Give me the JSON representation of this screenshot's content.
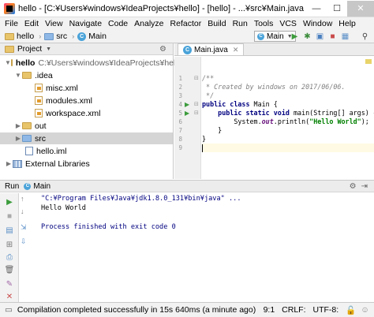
{
  "window": {
    "title": "hello - [C:¥Users¥windows¥IdeaProjects¥hello] - [hello] - ...¥src¥Main.java - IntelliJ IDEA 2017...",
    "minimize_glyph": "—",
    "maximize_glyph": "☐",
    "close_glyph": "✕"
  },
  "menu": [
    "File",
    "Edit",
    "View",
    "Navigate",
    "Code",
    "Analyze",
    "Refactor",
    "Build",
    "Run",
    "Tools",
    "VCS",
    "Window",
    "Help"
  ],
  "breadcrumbs": [
    "hello",
    "src",
    "Main"
  ],
  "toolbar": {
    "run_config": "Main",
    "icons": [
      "run-icon",
      "debug-icon",
      "coverage-icon",
      "stop-icon",
      "search-icon"
    ]
  },
  "project_panel": {
    "header": "Project",
    "tree": [
      {
        "label": "hello",
        "path": "C:¥Users¥windows¥IdeaProjects¥hello",
        "type": "folder",
        "expanded": true
      },
      {
        "label": ".idea",
        "type": "folder",
        "expanded": true
      },
      {
        "label": "misc.xml",
        "type": "xml"
      },
      {
        "label": "modules.xml",
        "type": "xml"
      },
      {
        "label": "workspace.xml",
        "type": "xml"
      },
      {
        "label": "out",
        "type": "folder",
        "expanded": false
      },
      {
        "label": "src",
        "type": "folder-blue",
        "expanded": false,
        "selected": true
      },
      {
        "label": "hello.iml",
        "type": "iml"
      },
      {
        "label": "External Libraries",
        "type": "libs",
        "expanded": false
      }
    ]
  },
  "editor": {
    "tab_label": "Main.java",
    "line_numbers": [
      "1",
      "2",
      "3",
      "4",
      "5",
      "6",
      "7",
      "8",
      "9"
    ],
    "code": {
      "l1": "/**",
      "l2": " * Created by windows on 2017/06/06.",
      "l3": " */",
      "l4_kw": "public class",
      "l4_rest": " Main {",
      "l5_kw": "    public static void",
      "l5_rest": " main(String[] args) {",
      "l6_a": "        System.",
      "l6_out": "out",
      "l6_b": ".println(",
      "l6_str": "\"Hello World\"",
      "l6_c": ");",
      "l7": "    }",
      "l8": "}"
    }
  },
  "run_panel": {
    "header_label": "Run",
    "tab_label": "Main",
    "console": [
      "\"C:¥Program Files¥Java¥jdk1.8.0_131¥bin¥java\" ...",
      "Hello World",
      "",
      "Process finished with exit code 0"
    ]
  },
  "status_bar": {
    "message": "Compilation completed successfully in 15s 640ms (a minute ago)",
    "position": "9:1",
    "line_sep": "CRLF:",
    "encoding": "UTF-8:"
  }
}
